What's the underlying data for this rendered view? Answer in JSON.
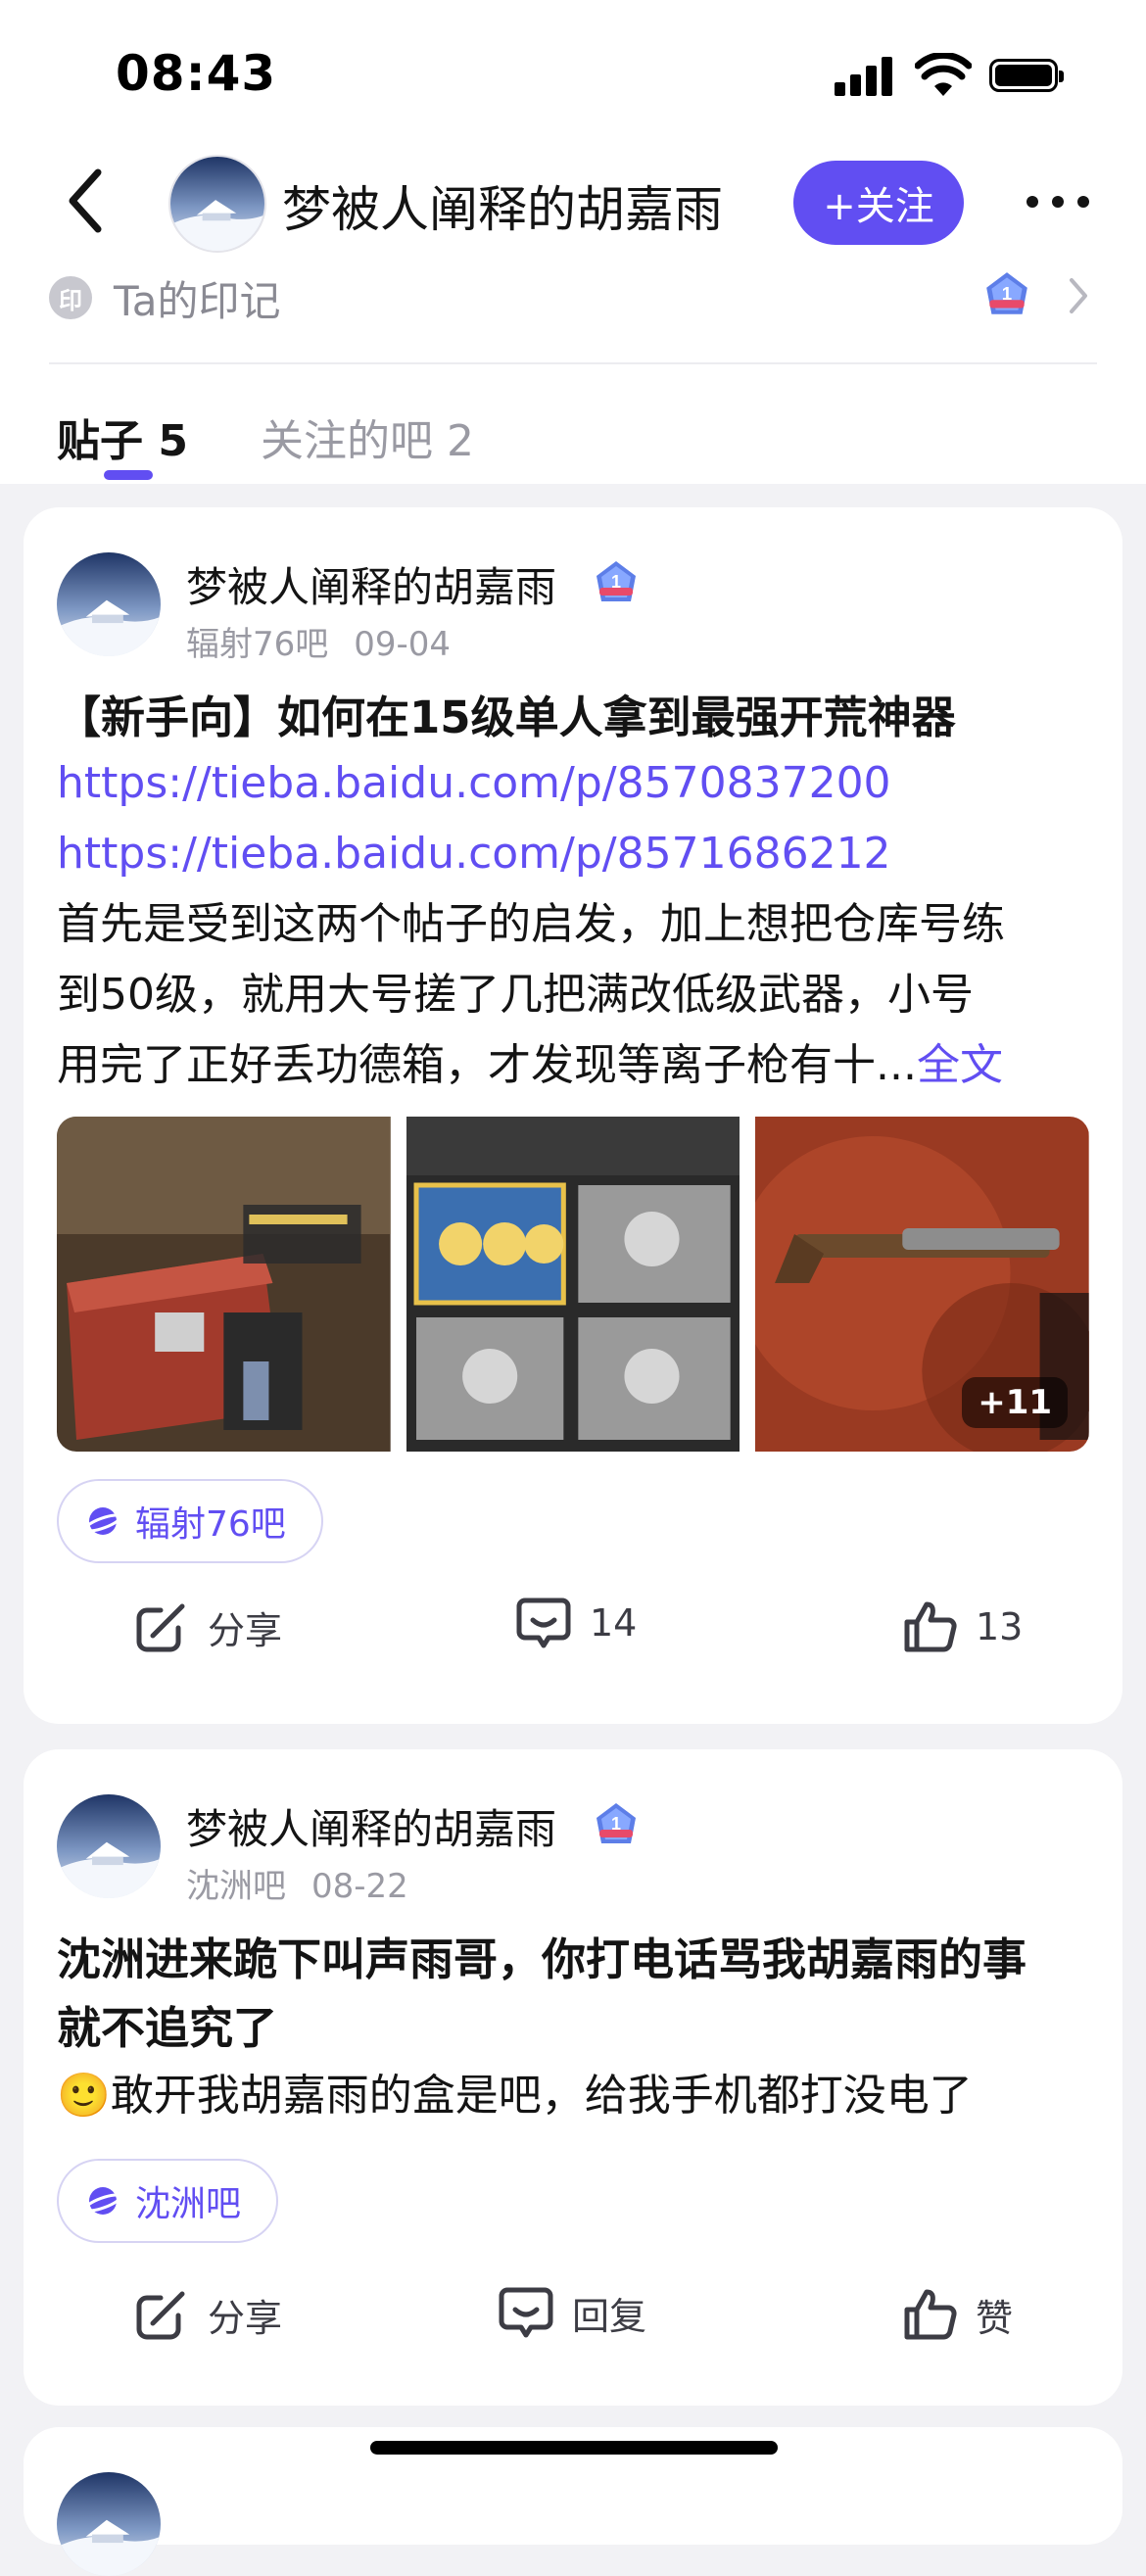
{
  "status_bar": {
    "time": "08:43"
  },
  "header": {
    "user_name": "梦被人阐释的胡嘉雨",
    "follow_label": "+关注",
    "seal_glyph": "印",
    "seal_label": "Ta的印记",
    "level_badge": "1"
  },
  "tabs": [
    {
      "label": "贴子 5",
      "active": true
    },
    {
      "label": "关注的吧 2",
      "active": false
    }
  ],
  "posts": [
    {
      "author": "梦被人阐释的胡嘉雨",
      "level": "1",
      "forum": "辐射76吧",
      "date": "09-04",
      "title": "【新手向】如何在15级单人拿到最强开荒神器",
      "links": [
        "https://tieba.baidu.com/p/8570837200",
        "https://tieba.baidu.com/p/8571686212"
      ],
      "body_lines": [
        "首先是受到这两个帖子的启发，加上想把仓库号练",
        "到50级，就用大号搓了几把满改低级武器，小号",
        "用完了正好丢功德箱，才发现等离子枪有十..."
      ],
      "full_text_label": "全文",
      "extra_images": "+11",
      "chip_label": "辐射76吧",
      "share_label": "分享",
      "comment_count": "14",
      "like_count": "13"
    },
    {
      "author": "梦被人阐释的胡嘉雨",
      "level": "1",
      "forum": "沈洲吧",
      "date": "08-22",
      "title_lines": [
        "沈洲进来跪下叫声雨哥，你打电话骂我胡嘉雨的事",
        "就不追究了"
      ],
      "emoji": "🙂",
      "body": "敢开我胡嘉雨的盒是吧，给我手机都打没电了",
      "chip_label": "沈洲吧",
      "share_label": "分享",
      "comment_label": "回复",
      "like_label": "赞"
    }
  ],
  "colors": {
    "accent": "#614ef2",
    "text": "#141414",
    "muted": "#9a9aa3",
    "page_bg": "#f2f2f5"
  }
}
